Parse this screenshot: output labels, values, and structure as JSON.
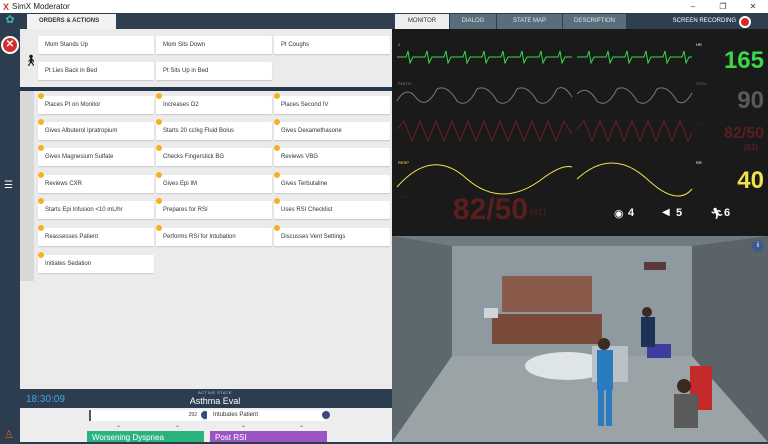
{
  "app": {
    "title": "SimX Moderator",
    "logo": "X",
    "min": "–",
    "max": "❐",
    "close": "✕"
  },
  "left_rail": {
    "settings_icon": "gear-icon",
    "close_icon": "close-icon"
  },
  "orders": {
    "tab_label": "ORDERS & ACTIONS",
    "actions": [
      "Mom Stands Up",
      "Mom Sits Down",
      "Pt Coughs",
      "Pt Lies Back in Bed",
      "Pt Sits Up in Bed"
    ],
    "orders_list": [
      "Places Pt on Monitor",
      "Increases O2",
      "Places Second IV",
      "Gives Albuterol Ipratropium",
      "Starts 20 cc/kg Fluid Bolus",
      "Gives Dexamethasone",
      "Gives Magnesium Sulfate",
      "Checks Fingerstick BG",
      "Reviews VBG",
      "Reviews CXR",
      "Gives Epi IM",
      "Gives Terbutaline",
      "Starts Epi Infusion <10 mL/hr",
      "Prepares for RSI",
      "Uses RSI Checklist",
      "Reassesses Patient",
      "Performs RSI for Intubation",
      "Discusses Vent Settings",
      "Initiates Sedation"
    ]
  },
  "footer": {
    "clock": "18:30:09",
    "active_state_label": "ACTIVE STATE",
    "active_state": "Asthma Eval",
    "timeline_count": "292",
    "timeline_next": "Intubates Patient",
    "state_worsening": "Worsening Dyspnea",
    "state_post_rsi": "Post RSI"
  },
  "monitor_tabs": [
    "MONITOR",
    "DIALOG",
    "STATE MAP",
    "DESCRIPTION"
  ],
  "screen_recording": "SCREEN RECORDING",
  "vitals": {
    "ecg_label": "II",
    "hr_label": "HR",
    "hr": "165",
    "hr_color": "#3dd64a",
    "pleth_label": "PLETH",
    "spo2_label": "SPO2",
    "spo2": "90",
    "spo2_color": "#5a5a5a",
    "art_label": "ART",
    "art": "82/50",
    "art_map": "(61)",
    "art_color": "#5a1e1e",
    "resp_label": "RESP",
    "rr_label": "RR",
    "rr": "40",
    "rr_color": "#f2e24a",
    "nibp_label": "NIBP",
    "nibp": "82/50",
    "nibp_map": "(61)",
    "eye": "4",
    "voice": "5",
    "motor": "6"
  }
}
